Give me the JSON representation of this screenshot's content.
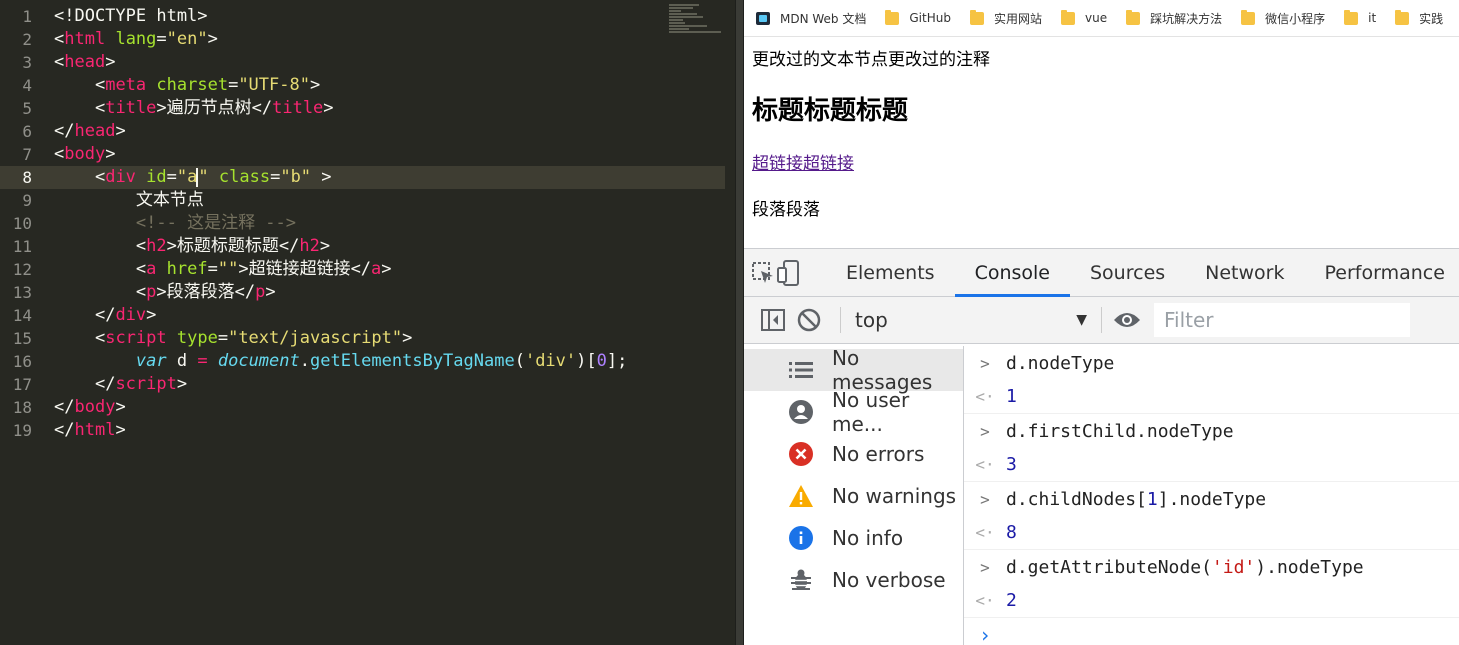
{
  "editor": {
    "line_numbers": [
      "1",
      "2",
      "3",
      "4",
      "5",
      "6",
      "7",
      "8",
      "9",
      "10",
      "11",
      "12",
      "13",
      "14",
      "15",
      "16",
      "17",
      "18",
      "19"
    ],
    "active_line": "8"
  },
  "browser": {
    "bookmarks": [
      {
        "label": "MDN Web 文档",
        "icon": "mdn-icon"
      },
      {
        "label": "GitHub",
        "icon": "folder-icon"
      },
      {
        "label": "实用网站",
        "icon": "folder-icon"
      },
      {
        "label": "vue",
        "icon": "folder-icon"
      },
      {
        "label": "踩坑解决方法",
        "icon": "folder-icon"
      },
      {
        "label": "微信小程序",
        "icon": "folder-icon"
      },
      {
        "label": "it",
        "icon": "folder-icon"
      },
      {
        "label": "实践",
        "icon": "folder-icon"
      }
    ],
    "page": {
      "text": "更改过的文本节点更改过的注释",
      "heading": "标题标题标题",
      "link": "超链接超链接",
      "paragraph": "段落段落"
    }
  },
  "devtools": {
    "tabs": [
      "Elements",
      "Console",
      "Sources",
      "Network",
      "Performance"
    ],
    "active_tab": "Console",
    "context": "top",
    "filter_placeholder": "Filter",
    "sidebar": [
      {
        "label": "No messages",
        "icon": "list-icon",
        "color": "#5f6368"
      },
      {
        "label": "No user me...",
        "icon": "user-icon",
        "color": "#5f6368"
      },
      {
        "label": "No errors",
        "icon": "error-icon",
        "color": "#d93025"
      },
      {
        "label": "No warnings",
        "icon": "warning-icon",
        "color": "#f9ab00"
      },
      {
        "label": "No info",
        "icon": "info-icon",
        "color": "#1a73e8"
      },
      {
        "label": "No verbose",
        "icon": "bug-icon",
        "color": "#5f6368"
      }
    ],
    "console": {
      "entries": [
        {
          "input": "d.nodeType",
          "result": "1"
        },
        {
          "input": "d.firstChild.nodeType",
          "result": "3"
        },
        {
          "input": "d.childNodes[1].nodeType",
          "result": "8"
        },
        {
          "input": "d.getAttributeNode('id').nodeType",
          "result": "2"
        }
      ]
    }
  }
}
